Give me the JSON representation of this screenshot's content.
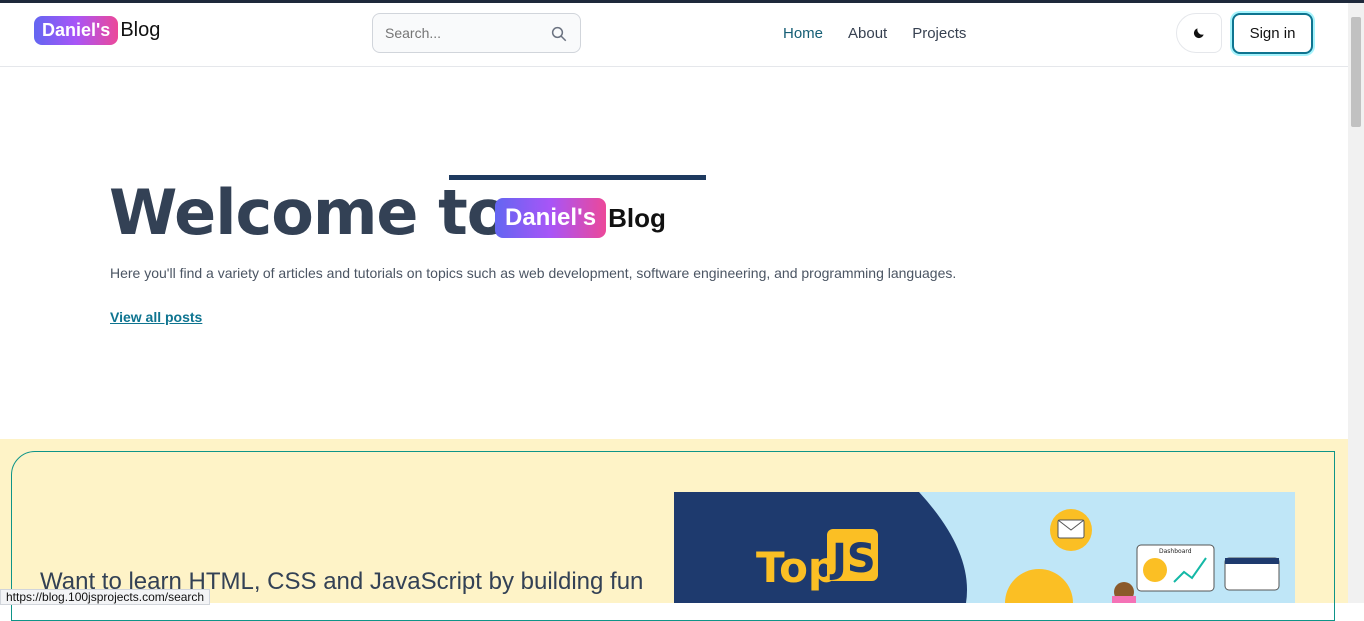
{
  "brand": {
    "badge": "Daniel's",
    "text": "Blog"
  },
  "search": {
    "placeholder": "Search..."
  },
  "nav": {
    "items": [
      "Home",
      "About",
      "Projects"
    ],
    "active": "Home"
  },
  "actions": {
    "signin_label": "Sign in",
    "theme_icon": "moon-icon"
  },
  "hero": {
    "title": "Welcome to",
    "description": "Here you'll find a variety of articles and tutorials on topics such as web development, software engineering, and programming languages.",
    "link_label": "View all posts"
  },
  "promo": {
    "heading": "Want to learn HTML, CSS and JavaScript by building fun",
    "image_text_top": "Top",
    "image_text_js": "JS",
    "dashboard_label": "Dashboard"
  },
  "status_bar": {
    "url": "https://blog.100jsprojects.com/search"
  },
  "colors": {
    "accent": "#0e7490",
    "promo_bg": "#fef3c7",
    "title": "#334155"
  }
}
